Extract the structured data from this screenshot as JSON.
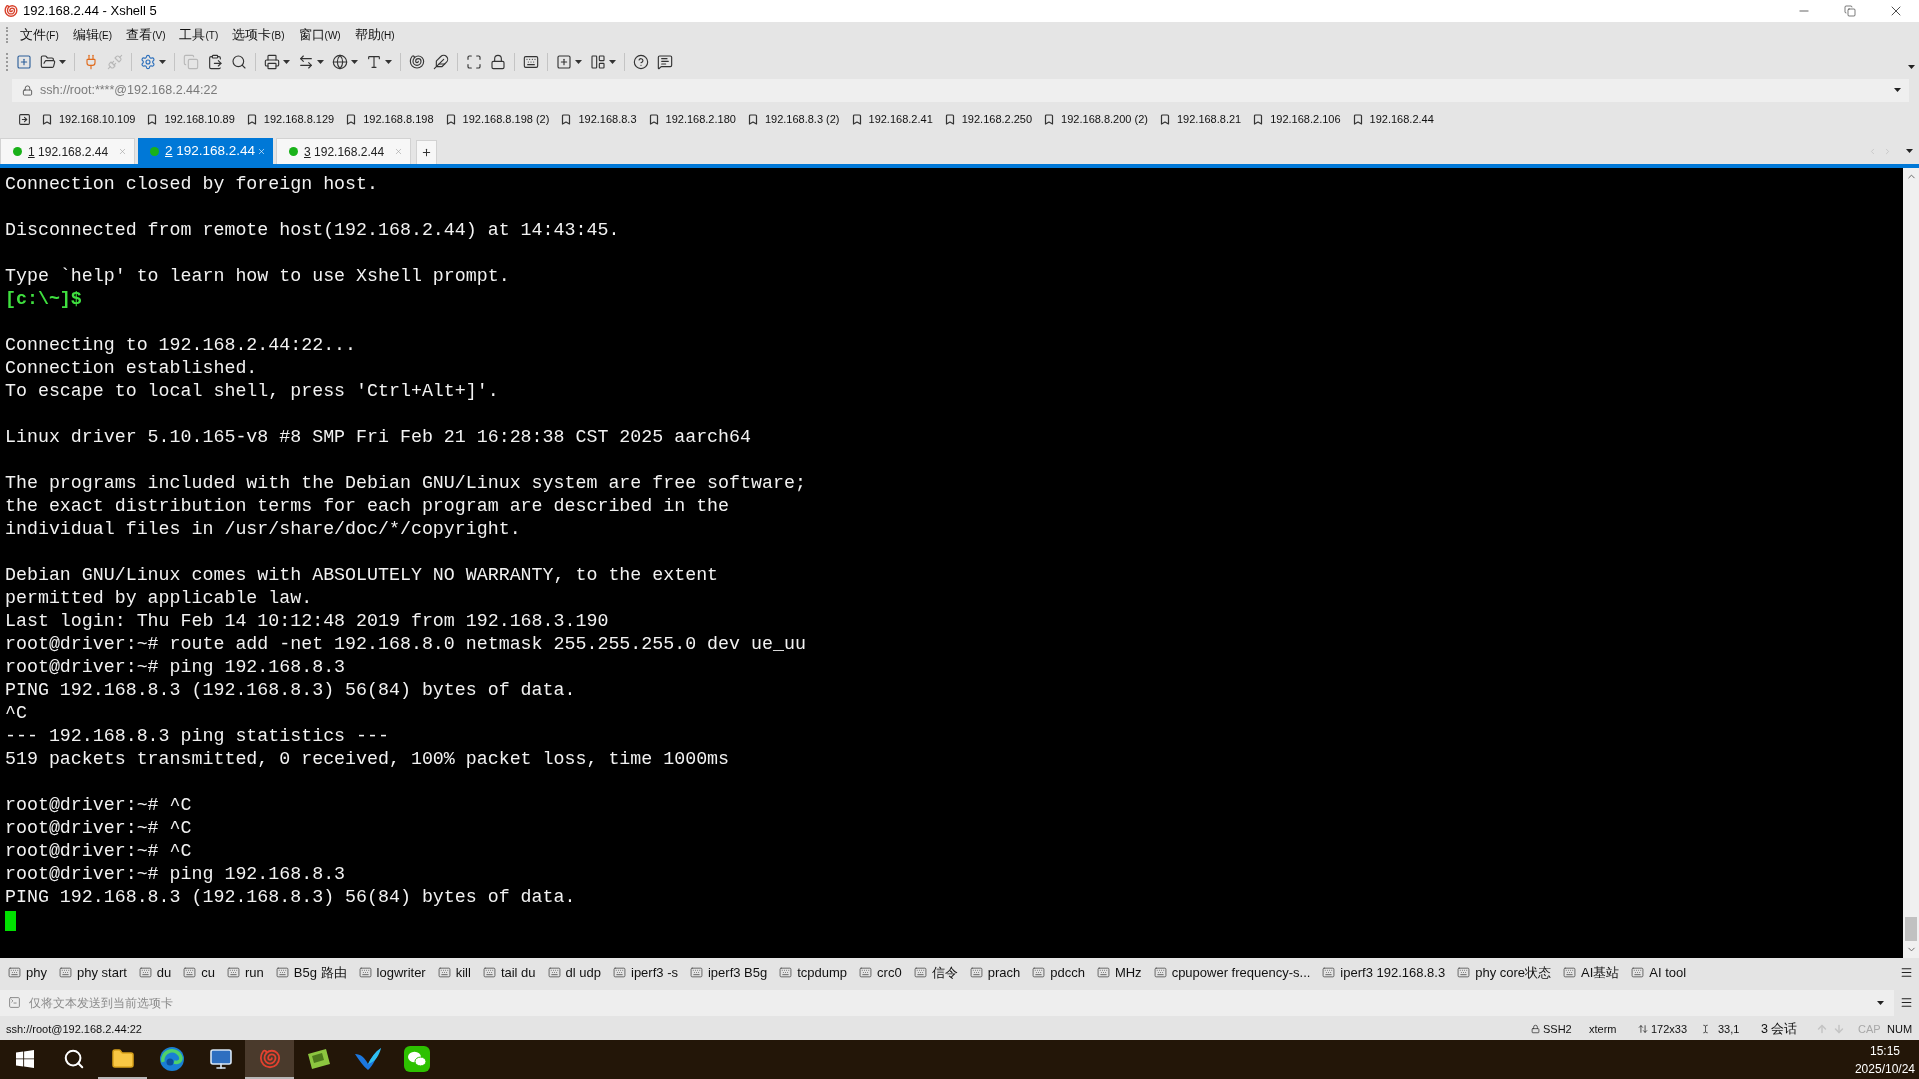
{
  "window": {
    "title": "192.168.2.44 - Xshell 5"
  },
  "menu": [
    {
      "label": "文件",
      "key": "(F)"
    },
    {
      "label": "编辑",
      "key": "(E)"
    },
    {
      "label": "查看",
      "key": "(V)"
    },
    {
      "label": "工具",
      "key": "(T)"
    },
    {
      "label": "选项卡",
      "key": "(B)"
    },
    {
      "label": "窗口",
      "key": "(W)"
    },
    {
      "label": "帮助",
      "key": "(H)"
    }
  ],
  "toolbar": [
    {
      "kind": "new_session",
      "disabled": false,
      "dropdown": false
    },
    {
      "kind": "open",
      "disabled": false,
      "dropdown": true
    },
    {
      "kind": "separator"
    },
    {
      "kind": "connect",
      "disabled": false,
      "dropdown": false
    },
    {
      "kind": "disconnect",
      "disabled": true,
      "dropdown": false
    },
    {
      "kind": "separator"
    },
    {
      "kind": "properties",
      "disabled": false,
      "dropdown": true
    },
    {
      "kind": "separator"
    },
    {
      "kind": "copy",
      "disabled": true,
      "dropdown": false
    },
    {
      "kind": "paste",
      "disabled": false,
      "dropdown": false
    },
    {
      "kind": "find",
      "disabled": false,
      "dropdown": false
    },
    {
      "kind": "separator"
    },
    {
      "kind": "print",
      "disabled": false,
      "dropdown": true
    },
    {
      "kind": "transfer",
      "disabled": false,
      "dropdown": true
    },
    {
      "kind": "encoding",
      "disabled": false,
      "dropdown": true
    },
    {
      "kind": "font",
      "disabled": false,
      "dropdown": true
    },
    {
      "kind": "separator"
    },
    {
      "kind": "xshell",
      "disabled": false,
      "dropdown": false
    },
    {
      "kind": "xftp",
      "disabled": false,
      "dropdown": false
    },
    {
      "kind": "separator"
    },
    {
      "kind": "fullscreen",
      "disabled": false,
      "dropdown": false
    },
    {
      "kind": "lock",
      "disabled": false,
      "dropdown": false
    },
    {
      "kind": "separator"
    },
    {
      "kind": "keyboard",
      "disabled": false,
      "dropdown": false
    },
    {
      "kind": "separator"
    },
    {
      "kind": "new_group",
      "disabled": false,
      "dropdown": true
    },
    {
      "kind": "layout",
      "disabled": false,
      "dropdown": true
    },
    {
      "kind": "separator"
    },
    {
      "kind": "help",
      "disabled": false,
      "dropdown": false
    },
    {
      "kind": "chat",
      "disabled": false,
      "dropdown": false
    }
  ],
  "address_bar": {
    "value": "ssh://root:****@192.168.2.44:22"
  },
  "links_bar": [
    "192.168.10.109",
    "192.168.10.89",
    "192.168.8.129",
    "192.168.8.198",
    "192.168.8.198 (2)",
    "192.168.8.3",
    "192.168.2.180",
    "192.168.8.3 (2)",
    "192.168.2.41",
    "192.168.2.250",
    "192.168.8.200 (2)",
    "192.168.8.21",
    "192.168.2.106",
    "192.168.2.44"
  ],
  "tabs": [
    {
      "number": "1",
      "label": "192.168.2.44",
      "selected": false,
      "connected": true
    },
    {
      "number": "2",
      "label": "192.168.2.44",
      "selected": true,
      "connected": true
    },
    {
      "number": "3",
      "label": "192.168.2.44",
      "selected": false,
      "connected": true
    }
  ],
  "terminal": {
    "blocks": [
      {
        "lines": [
          {
            "kind": "output",
            "text": "Connection closed by foreign host."
          }
        ]
      },
      {
        "lines": [
          {
            "kind": "output",
            "text": "Disconnected from remote host(192.168.2.44) at 14:43:45."
          }
        ]
      },
      {
        "lines": [
          {
            "kind": "output",
            "text": "Type `help' to learn how to use Xshell prompt."
          },
          {
            "kind": "local_prompt",
            "text": "[c:\\~]$"
          }
        ]
      },
      {
        "lines": [
          {
            "kind": "output",
            "text": "Connecting to 192.168.2.44:22..."
          },
          {
            "kind": "output",
            "text": "Connection established."
          },
          {
            "kind": "output",
            "text": "To escape to local shell, press 'Ctrl+Alt+]'."
          }
        ]
      },
      {
        "lines": [
          {
            "kind": "output",
            "text": "Linux driver 5.10.165-v8 #8 SMP Fri Feb 21 16:28:38 CST 2025 aarch64"
          }
        ]
      },
      {
        "lines": [
          {
            "kind": "output",
            "text": "The programs included with the Debian GNU/Linux system are free software;"
          },
          {
            "kind": "output",
            "text": "the exact distribution terms for each program are described in the"
          },
          {
            "kind": "output",
            "text": "individual files in /usr/share/doc/*/copyright."
          }
        ]
      },
      {
        "lines": [
          {
            "kind": "output",
            "text": "Debian GNU/Linux comes with ABSOLUTELY NO WARRANTY, to the extent"
          },
          {
            "kind": "output",
            "text": "permitted by applicable law."
          },
          {
            "kind": "output",
            "text": "Last login: Thu Feb 14 10:12:48 2019 from 192.168.3.190"
          },
          {
            "kind": "output",
            "text": "root@driver:~# route add -net 192.168.8.0 netmask 255.255.255.0 dev ue_uu"
          },
          {
            "kind": "output",
            "text": "root@driver:~# ping 192.168.8.3"
          },
          {
            "kind": "output",
            "text": "PING 192.168.8.3 (192.168.8.3) 56(84) bytes of data."
          },
          {
            "kind": "output",
            "text": "^C"
          },
          {
            "kind": "output",
            "text": "--- 192.168.8.3 ping statistics ---"
          },
          {
            "kind": "output",
            "text": "519 packets transmitted, 0 received, 100% packet loss, time 1000ms"
          }
        ]
      },
      {
        "lines": [
          {
            "kind": "output",
            "text": "root@driver:~# ^C"
          },
          {
            "kind": "output",
            "text": "root@driver:~# ^C"
          },
          {
            "kind": "output",
            "text": "root@driver:~# ^C"
          },
          {
            "kind": "output",
            "text": "root@driver:~# ping 192.168.8.3"
          },
          {
            "kind": "output",
            "text": "PING 192.168.8.3 (192.168.8.3) 56(84) bytes of data."
          }
        ]
      }
    ]
  },
  "quick_commands": [
    "phy",
    "phy start",
    "du",
    "cu",
    "run",
    "B5g 路由",
    "logwriter",
    "kill",
    "tail du",
    "dl udp",
    "iperf3 -s",
    "iperf3 B5g",
    "tcpdump",
    "crc0",
    "信令",
    "prach",
    "pdcch",
    "MHz",
    "cpupower frequency-s...",
    "iperf3 192.168.8.3",
    "phy core状态",
    "AI基站",
    "AI tool"
  ],
  "send_bar": {
    "placeholder": "仅将文本发送到当前选项卡"
  },
  "status_bar": {
    "address": "ssh://root@192.168.2.44:22",
    "protocol": "SSH2",
    "terminal_type": "xterm",
    "size": "172x33",
    "cursor": "33,1",
    "sessions": "3 会话",
    "nav_disabled": true,
    "caps": {
      "label": "CAP",
      "on": false
    },
    "num": {
      "label": "NUM",
      "on": true
    }
  },
  "taskbar": {
    "apps": [
      {
        "kind": "start",
        "selected": false,
        "running": false
      },
      {
        "kind": "search",
        "selected": false,
        "running": false
      },
      {
        "kind": "explorer",
        "selected": false,
        "running": true
      },
      {
        "kind": "browser",
        "selected": false,
        "running": false
      },
      {
        "kind": "remote",
        "selected": false,
        "running": false
      },
      {
        "kind": "shell",
        "selected": true,
        "running": true
      },
      {
        "kind": "card",
        "selected": false,
        "running": false
      },
      {
        "kind": "bird",
        "selected": false,
        "running": false
      },
      {
        "kind": "chat",
        "selected": false,
        "running": false
      }
    ],
    "time": "15:15",
    "date": "2025/10/24"
  }
}
